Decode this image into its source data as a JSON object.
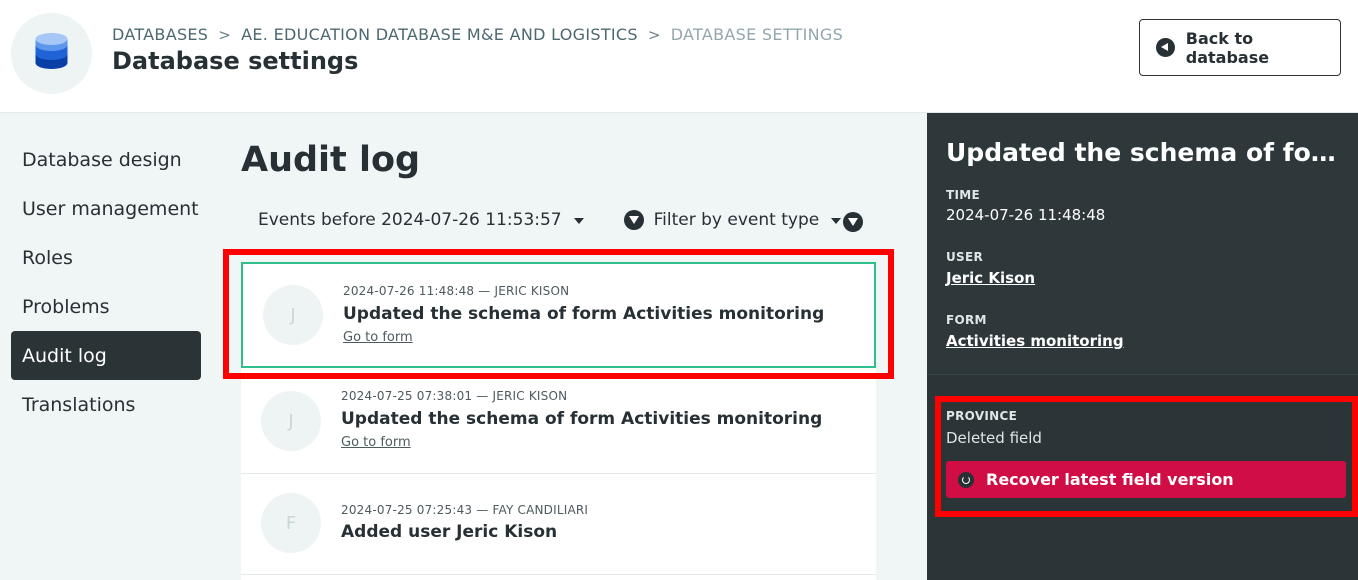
{
  "header": {
    "breadcrumb": [
      "DATABASES",
      "AE. EDUCATION DATABASE M&E AND LOGISTICS",
      "DATABASE SETTINGS"
    ],
    "separator": ">",
    "title": "Database settings",
    "back_button": "Back to database",
    "logo_icon": "database-icon"
  },
  "sidebar": {
    "items": [
      {
        "label": "Database design",
        "active": false
      },
      {
        "label": "User management",
        "active": false
      },
      {
        "label": "Roles",
        "active": false
      },
      {
        "label": "Problems",
        "active": false
      },
      {
        "label": "Audit log",
        "active": true
      },
      {
        "label": "Translations",
        "active": false
      }
    ]
  },
  "main": {
    "title": "Audit log",
    "events_before": "Events before 2024-07-26 11:53:57",
    "filter_label": "Filter by event type",
    "events": [
      {
        "avatar": "J",
        "meta": "2024-07-26 11:48:48 — JERIC KISON",
        "title": "Updated the schema of form Activities monitoring",
        "link": "Go to form",
        "selected": true
      },
      {
        "avatar": "J",
        "meta": "2024-07-25 07:38:01 — JERIC KISON",
        "title": "Updated the schema of form Activities monitoring",
        "link": "Go to form",
        "selected": false
      },
      {
        "avatar": "F",
        "meta": "2024-07-25 07:25:43 — FAY CANDILIARI",
        "title": "Added user Jeric Kison",
        "link": "",
        "selected": false
      }
    ]
  },
  "detail": {
    "title": "Updated the schema of form A...",
    "time_label": "TIME",
    "time_value": "2024-07-26 11:48:48",
    "user_label": "USER",
    "user_value": "Jeric Kison",
    "form_label": "FORM",
    "form_value": "Activities monitoring",
    "field_label": "PROVINCE",
    "field_status": "Deleted field",
    "recover_button": "Recover latest field version"
  },
  "colors": {
    "accent_red": "#d00d44",
    "highlight": "#ff0000",
    "selected_border": "#2fbf8a",
    "dark_panel": "#2b3436"
  }
}
